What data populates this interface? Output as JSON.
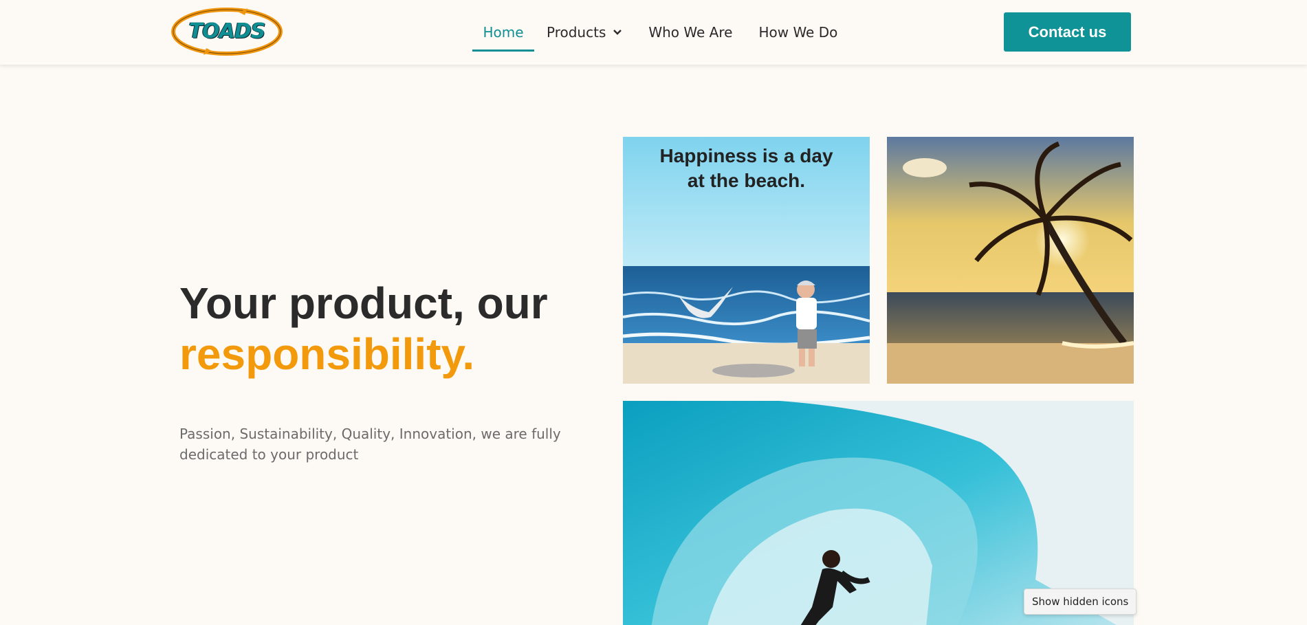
{
  "brand": {
    "logo_text": "TOADS"
  },
  "nav": {
    "items": [
      {
        "label": "Home",
        "active": true
      },
      {
        "label": "Products",
        "active": false,
        "has_dropdown": true
      },
      {
        "label": "Who We Are",
        "active": false
      },
      {
        "label": "How We Do",
        "active": false
      }
    ]
  },
  "header": {
    "contact_label": "Contact us"
  },
  "hero": {
    "title_line1": "Your product, our",
    "title_line2": "responsibility.",
    "description": "Passion, Sustainability, Quality, Innovation, we are fully dedicated to your product"
  },
  "gallery": {
    "beach_caption_line1": "Happiness is a day",
    "beach_caption_line2": "at the beach."
  },
  "tooltip": {
    "text": "Show hidden icons"
  },
  "colors": {
    "accent_teal": "#0f9397",
    "accent_orange": "#f29a0c",
    "background": "#fdf9f5",
    "heading": "#2b2b2b"
  },
  "icons": {
    "dropdown": "chevron-down-icon"
  }
}
